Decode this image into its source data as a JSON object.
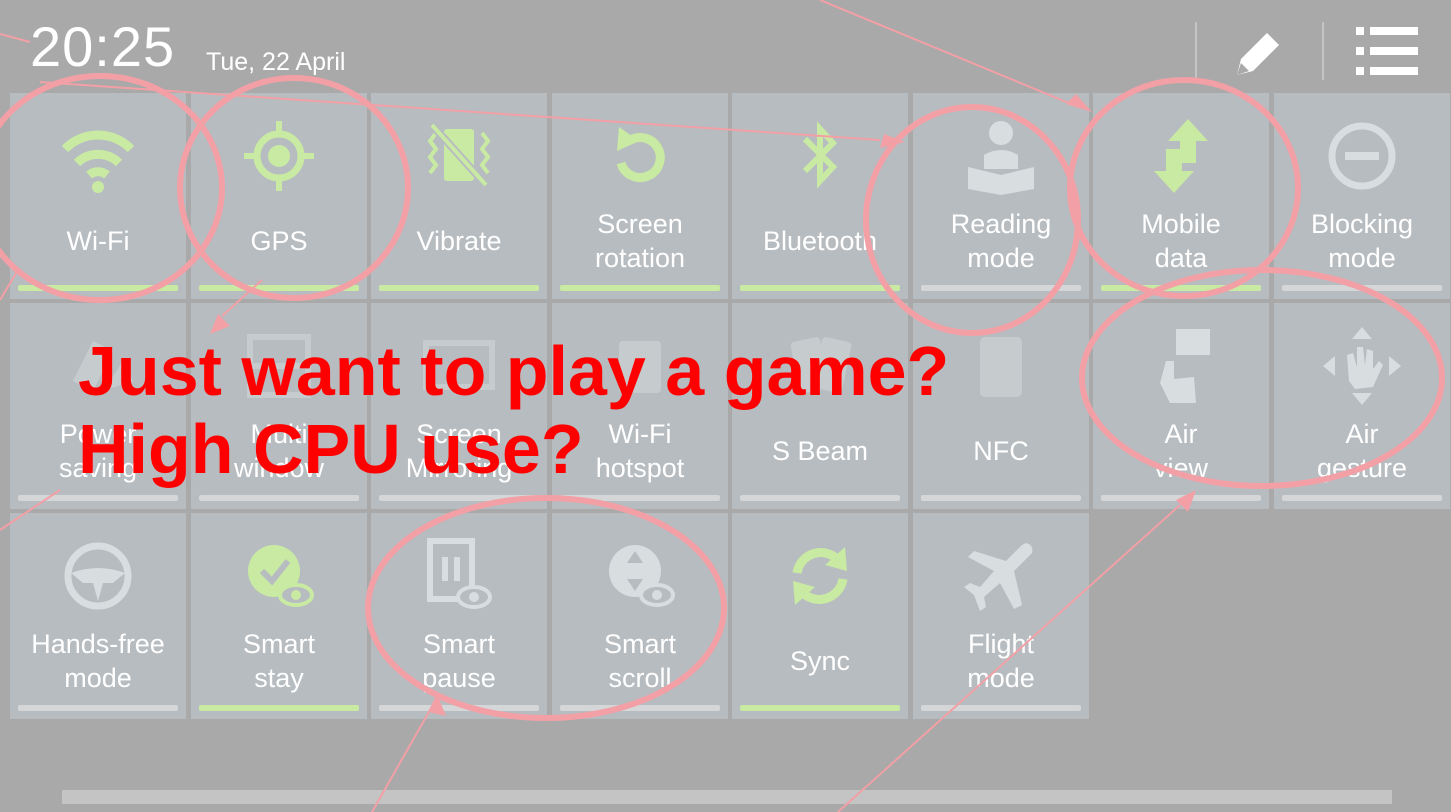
{
  "status": {
    "time": "20:25",
    "date": "Tue, 22 April"
  },
  "header_actions": [
    {
      "name": "edit-button",
      "icon": "pencil-icon"
    },
    {
      "name": "list-button",
      "icon": "list-icon"
    }
  ],
  "tiles": [
    {
      "label": "Wi-Fi",
      "icon": "wifi-icon",
      "on": true
    },
    {
      "label": "GPS",
      "icon": "gps-icon",
      "on": true
    },
    {
      "label": "Vibrate",
      "icon": "vibrate-icon",
      "on": true
    },
    {
      "label": "Screen\nrotation",
      "icon": "rotation-icon",
      "on": true
    },
    {
      "label": "Bluetooth",
      "icon": "bluetooth-icon",
      "on": true
    },
    {
      "label": "Reading\nmode",
      "icon": "reading-icon",
      "on": false
    },
    {
      "label": "Mobile\ndata",
      "icon": "mobile-data-icon",
      "on": true
    },
    {
      "label": "Blocking\nmode",
      "icon": "blocking-icon",
      "on": false
    },
    {
      "label": "Power\nsaving",
      "icon": "power-saving-icon",
      "on": false
    },
    {
      "label": "Multi\nwindow",
      "icon": "multi-window-icon",
      "on": false
    },
    {
      "label": "Screen\nMirroring",
      "icon": "mirroring-icon",
      "on": false
    },
    {
      "label": "Wi-Fi\nhotspot",
      "icon": "hotspot-icon",
      "on": false
    },
    {
      "label": "S Beam",
      "icon": "s-beam-icon",
      "on": false
    },
    {
      "label": "NFC",
      "icon": "nfc-icon",
      "on": false
    },
    {
      "label": "Air\nview",
      "icon": "air-view-icon",
      "on": false
    },
    {
      "label": "Air\ngesture",
      "icon": "air-gesture-icon",
      "on": false
    },
    {
      "label": "Hands-free\nmode",
      "icon": "steering-wheel-icon",
      "on": false
    },
    {
      "label": "Smart\nstay",
      "icon": "smart-stay-icon",
      "on": true
    },
    {
      "label": "Smart\npause",
      "icon": "smart-pause-icon",
      "on": false
    },
    {
      "label": "Smart\nscroll",
      "icon": "smart-scroll-icon",
      "on": false
    },
    {
      "label": "Sync",
      "icon": "sync-icon",
      "on": true
    },
    {
      "label": "Flight\nmode",
      "icon": "airplane-icon",
      "on": false
    }
  ],
  "annotation": {
    "line1": "Just want to play a game?",
    "line2": "High CPU use?",
    "color": "#ff0000",
    "circle_color": "#f2a0a6"
  },
  "colors": {
    "active": "#c9eaa2",
    "tile": "#b7bcc0",
    "background": "#a9a9a9"
  }
}
